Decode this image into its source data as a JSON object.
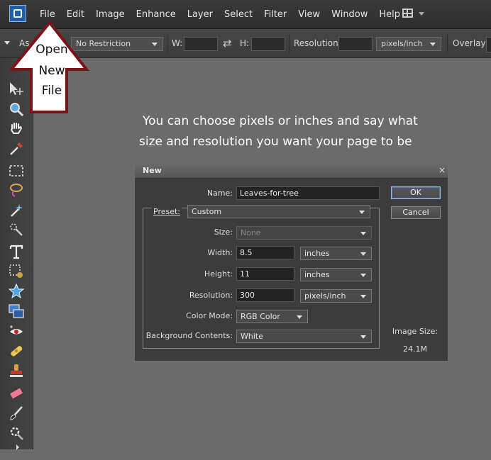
{
  "menu": [
    "File",
    "Edit",
    "Image",
    "Enhance",
    "Layer",
    "Select",
    "Filter",
    "View",
    "Window",
    "Help"
  ],
  "options_bar": {
    "aspect_label": "As",
    "aspect_value": "No Restriction",
    "width_label": "W:",
    "height_label": "H:",
    "resolution_label": "Resolution:",
    "resolution_unit": "pixels/inch",
    "overlay_label": "Overlay:"
  },
  "annotation": {
    "arrow_lines": [
      "Open",
      "New",
      "File"
    ],
    "instruction_line1": "You can choose  pixels or inches and say what",
    "instruction_line2": "size and resolution you want your page to be"
  },
  "dialog": {
    "title": "New",
    "close": "×",
    "name_label": "Name:",
    "name_value": "Leaves-for-tree",
    "preset_label": "Preset:",
    "preset_value": "Custom",
    "size_label": "Size:",
    "size_value": "None",
    "width_label": "Width:",
    "width_value": "8.5",
    "width_unit": "inches",
    "height_label": "Height:",
    "height_value": "11",
    "height_unit": "inches",
    "resolution_label": "Resolution:",
    "resolution_value": "300",
    "resolution_unit": "pixels/inch",
    "color_mode_label": "Color Mode:",
    "color_mode_value": "RGB Color",
    "background_label": "Background Contents:",
    "background_value": "White",
    "ok": "OK",
    "cancel": "Cancel",
    "image_size_label": "Image Size:",
    "image_size_value": "24.1M"
  }
}
